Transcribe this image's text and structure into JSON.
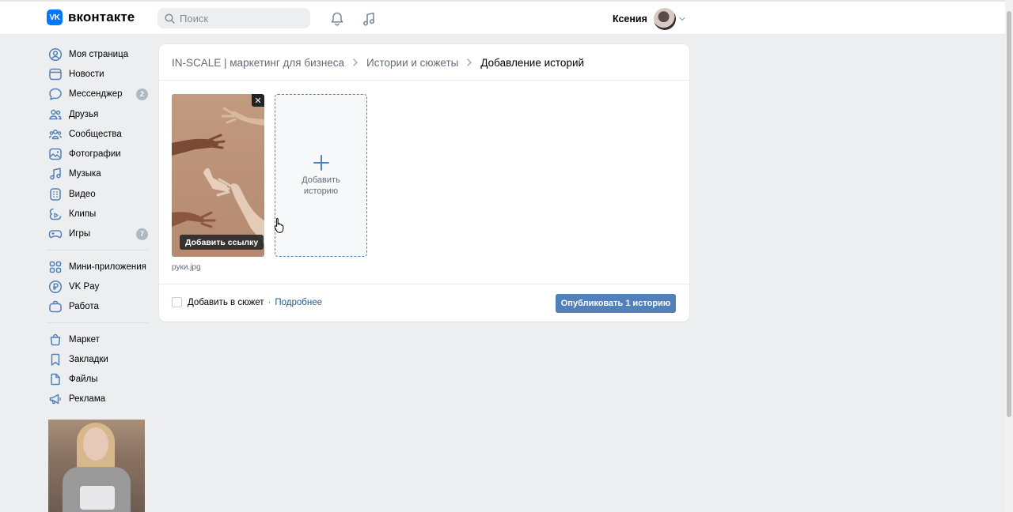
{
  "header": {
    "logo_mark": "VK",
    "logo_text": "вконтакте",
    "search_placeholder": "Поиск",
    "user_name": "Ксения",
    "icons": [
      "bell-icon",
      "music-note-icon",
      "chevron-down-icon"
    ]
  },
  "sidebar": {
    "group1": [
      {
        "label": "Моя страница",
        "icon": "user-circle-icon"
      },
      {
        "label": "Новости",
        "icon": "news-icon"
      },
      {
        "label": "Мессенджер",
        "icon": "message-icon",
        "badge": "2"
      },
      {
        "label": "Друзья",
        "icon": "friends-icon"
      },
      {
        "label": "Сообщества",
        "icon": "communities-icon"
      },
      {
        "label": "Фотографии",
        "icon": "photo-icon"
      },
      {
        "label": "Музыка",
        "icon": "music-icon"
      },
      {
        "label": "Видео",
        "icon": "video-icon"
      },
      {
        "label": "Клипы",
        "icon": "clips-icon"
      },
      {
        "label": "Игры",
        "icon": "gamepad-icon",
        "badge": "7"
      }
    ],
    "group2": [
      {
        "label": "Мини-приложения",
        "icon": "apps-icon"
      },
      {
        "label": "VK Pay",
        "icon": "ruble-icon"
      },
      {
        "label": "Работа",
        "icon": "briefcase-icon"
      }
    ],
    "group3": [
      {
        "label": "Маркет",
        "icon": "bag-icon"
      },
      {
        "label": "Закладки",
        "icon": "bookmark-icon"
      },
      {
        "label": "Файлы",
        "icon": "file-icon"
      },
      {
        "label": "Реклама",
        "icon": "megaphone-icon"
      }
    ]
  },
  "breadcrumb": {
    "items": [
      "IN-SCALE | маркетинг для бизнеса",
      "Истории и сюжеты",
      "Добавление историй"
    ]
  },
  "story": {
    "link_button": "Добавить ссылку",
    "file_name": "руки.jpg",
    "close_glyph": "✕"
  },
  "add_story": {
    "label_line1": "Добавить",
    "label_line2": "историю"
  },
  "footer": {
    "checkbox_label": "Добавить в сюжет",
    "separator": "·",
    "more_link": "Подробнее",
    "publish_button": "Опубликовать 1 историю"
  },
  "colors": {
    "brand": "#0077ff",
    "accent": "#5181b8",
    "link": "#2a5885",
    "badge": "#aeb7c2",
    "background": "#edeef0"
  }
}
